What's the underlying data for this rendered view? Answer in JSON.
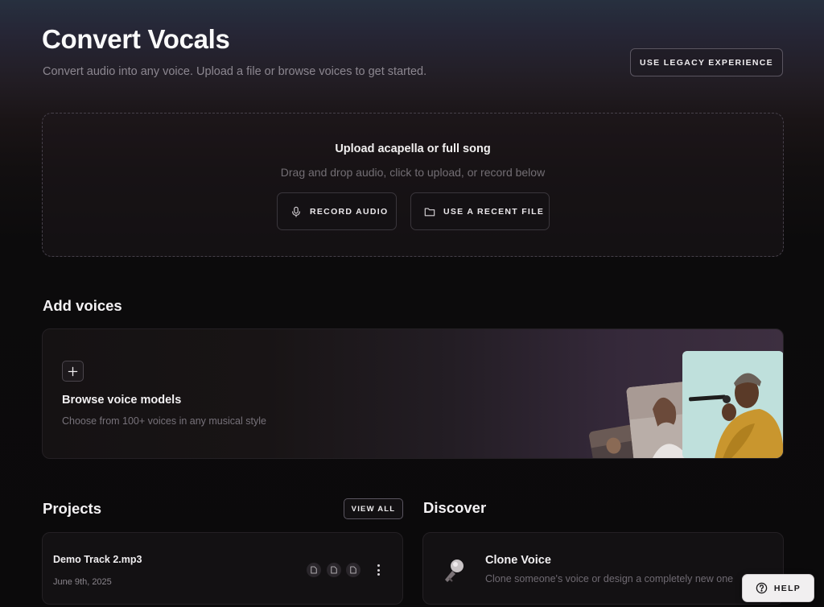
{
  "header": {
    "title": "Convert Vocals",
    "subtitle": "Convert audio into any voice. Upload a file or browse voices to get started.",
    "legacy_label": "USE LEGACY EXPERIENCE"
  },
  "upload": {
    "title": "Upload acapella or full song",
    "subtitle": "Drag and drop audio, click to upload, or record below",
    "record_label": "RECORD AUDIO",
    "recent_label": "USE A RECENT FILE",
    "record_icon": "microphone-icon",
    "recent_icon": "folder-icon"
  },
  "voices": {
    "section_title": "Add voices",
    "card_title": "Browse voice models",
    "card_subtitle": "Choose from 100+ voices in any musical style",
    "add_icon": "plus-icon"
  },
  "projects": {
    "section_title": "Projects",
    "view_all_label": "VIEW ALL",
    "items": [
      {
        "name": "Demo Track 2.mp3",
        "date": "June 9th, 2025"
      }
    ]
  },
  "discover": {
    "section_title": "Discover",
    "items": [
      {
        "title": "Clone Voice",
        "subtitle": "Clone someone's voice or design a completely new one"
      }
    ]
  },
  "help": {
    "label": "HELP",
    "icon": "question-circle-icon"
  },
  "colors": {
    "background": "#0c0b0c",
    "card": "#131113",
    "border": "#242024",
    "muted_text": "#8c8790"
  }
}
